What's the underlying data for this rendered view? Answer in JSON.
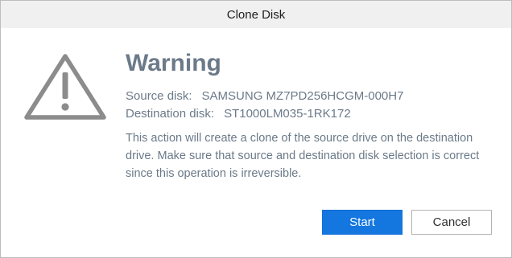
{
  "window": {
    "title": "Clone Disk"
  },
  "icon": {
    "name": "warning-triangle-icon",
    "color": "#8c8c8c"
  },
  "dialog": {
    "heading": "Warning",
    "source_label": "Source disk:",
    "source_value": "SAMSUNG MZ7PD256HCGM-000H7",
    "destination_label": "Destination disk:",
    "destination_value": "ST1000LM035-1RK172",
    "message": "This action will create a clone of the source drive on the destination drive. Make sure that source and destination disk selection is correct since this operation is irreversible."
  },
  "buttons": {
    "start_label": "Start",
    "cancel_label": "Cancel"
  },
  "colors": {
    "accent": "#1477df",
    "text": "#6b7a89"
  }
}
